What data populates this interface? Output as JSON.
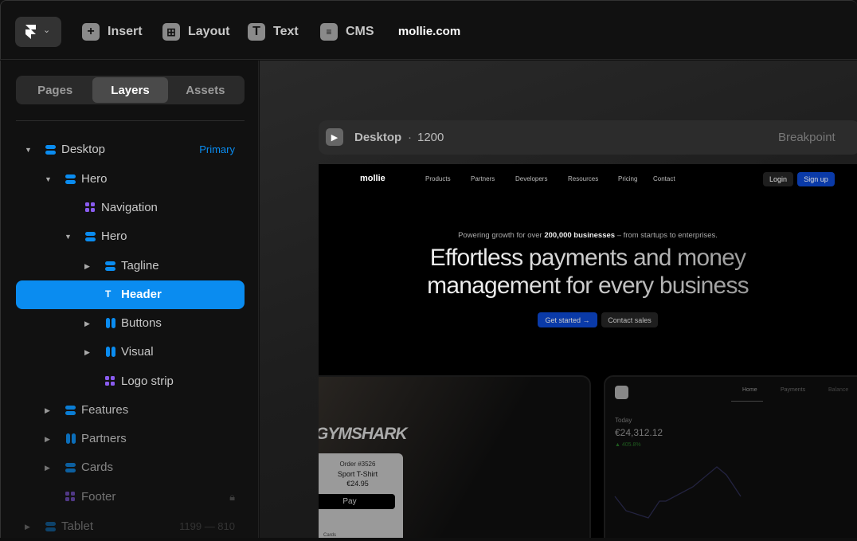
{
  "toolbar": {
    "insert": "Insert",
    "layout": "Layout",
    "text": "Text",
    "cms": "CMS",
    "site": "mollie.com"
  },
  "sidebar": {
    "tabs": [
      "Pages",
      "Layers",
      "Assets"
    ],
    "layers": [
      {
        "label": "Desktop",
        "badge": "Primary"
      },
      {
        "label": "Hero"
      },
      {
        "label": "Navigation"
      },
      {
        "label": "Hero"
      },
      {
        "label": "Tagline"
      },
      {
        "label": "Header"
      },
      {
        "label": "Buttons"
      },
      {
        "label": "Visual"
      },
      {
        "label": "Logo strip"
      },
      {
        "label": "Features"
      },
      {
        "label": "Partners"
      },
      {
        "label": "Cards"
      },
      {
        "label": "Footer"
      },
      {
        "label": "Tablet",
        "range": "1199 — 810"
      }
    ]
  },
  "frame": {
    "name": "Desktop",
    "width": "1200",
    "breakpoint": "Breakpoint"
  },
  "site": {
    "logo": "mollie",
    "nav": [
      "Products",
      "Partners",
      "Developers",
      "Resources",
      "Pricing",
      "Contact"
    ],
    "login": "Login",
    "signup": "Sign up",
    "tagline_pre": "Powering growth for over ",
    "tagline_bold": "200,000 businesses",
    "tagline_post": " – from startups to enterprises.",
    "headline1": "Effortless payments and money",
    "headline2": "management for every business",
    "cta1": "Get started →",
    "cta2": "Contact sales",
    "brand": "GYMSHARK",
    "order": "Order #3526",
    "product": "Sport T-Shirt",
    "price": "€24.95",
    "pay": " Pay",
    "cards": "Cards",
    "dash_tabs": [
      "Home",
      "Payments",
      "Balance"
    ],
    "today": "Today",
    "amount": "€24,312.12",
    "change": "▲ 405.8%"
  }
}
